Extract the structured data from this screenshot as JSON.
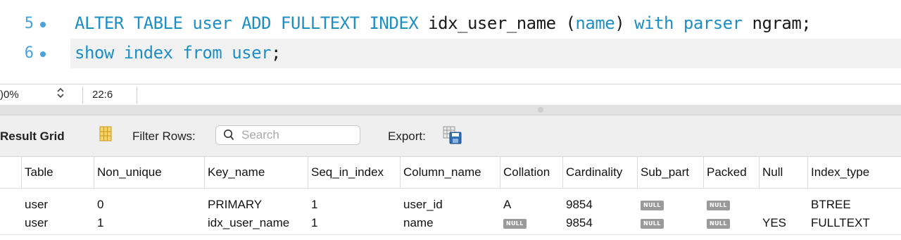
{
  "editor": {
    "lines": [
      {
        "number": "5",
        "tokens": [
          {
            "text": "ALTER TABLE ",
            "kind": "kw"
          },
          {
            "text": "user",
            "kind": "kw"
          },
          {
            "text": " ADD FULLTEXT INDEX ",
            "kind": "kw"
          },
          {
            "text": "idx_user_name ",
            "kind": "tx"
          },
          {
            "text": "(",
            "kind": "tx"
          },
          {
            "text": "name",
            "kind": "kw"
          },
          {
            "text": ") ",
            "kind": "tx"
          },
          {
            "text": "with parser ",
            "kind": "kw"
          },
          {
            "text": "ngram;",
            "kind": "tx"
          }
        ]
      },
      {
        "number": "6",
        "tokens": [
          {
            "text": "show index from user",
            "kind": "kw"
          },
          {
            "text": ";",
            "kind": "tx"
          }
        ]
      }
    ]
  },
  "statusbar": {
    "zoom": ")0%",
    "zoom_stepper": "◇",
    "cursor_position": "22:6"
  },
  "toolbar": {
    "result_grid_label": "Result Grid",
    "filter_rows_label": "Filter Rows:",
    "search_placeholder": "Search",
    "export_label": "Export:"
  },
  "table": {
    "columns": [
      "Table",
      "Non_unique",
      "Key_name",
      "Seq_in_index",
      "Column_name",
      "Collation",
      "Cardinality",
      "Sub_part",
      "Packed",
      "Null",
      "Index_type"
    ],
    "null_label": "NULL",
    "rows": [
      [
        "user",
        "0",
        "PRIMARY",
        "1",
        "user_id",
        "A",
        "9854",
        null,
        null,
        "",
        "BTREE"
      ],
      [
        "user",
        "1",
        "idx_user_name",
        "1",
        "name",
        null,
        "9854",
        null,
        null,
        "YES",
        "FULLTEXT"
      ]
    ]
  },
  "colors": {
    "keyword": "#1d8fc7",
    "line_number": "#4aa3d8",
    "null_badge": "#9a9a9a"
  }
}
